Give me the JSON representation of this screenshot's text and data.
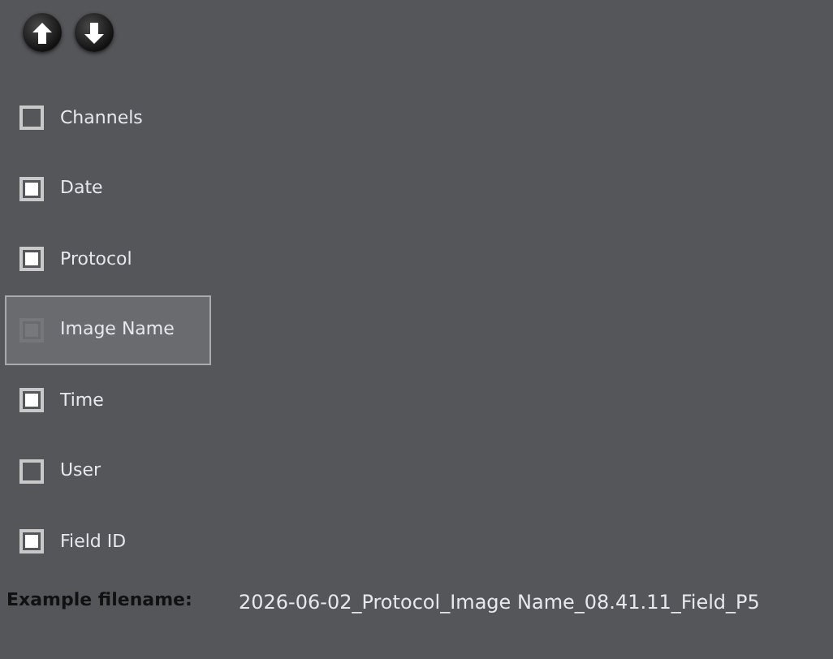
{
  "move_buttons": [
    {
      "kind": "up"
    },
    {
      "kind": "down"
    }
  ],
  "fields": [
    {
      "label": "Channels",
      "checked": false,
      "selected": false
    },
    {
      "label": "Date",
      "checked": true,
      "selected": false
    },
    {
      "label": "Protocol",
      "checked": true,
      "selected": false
    },
    {
      "label": "Image Name",
      "checked": true,
      "selected": true
    },
    {
      "label": "Time",
      "checked": true,
      "selected": false
    },
    {
      "label": "User",
      "checked": false,
      "selected": false
    },
    {
      "label": "Field ID",
      "checked": true,
      "selected": false
    }
  ],
  "example": {
    "label": "Example filename:",
    "value": "2026-06-02_Protocol_Image Name_08.41.11_Field_P5"
  }
}
